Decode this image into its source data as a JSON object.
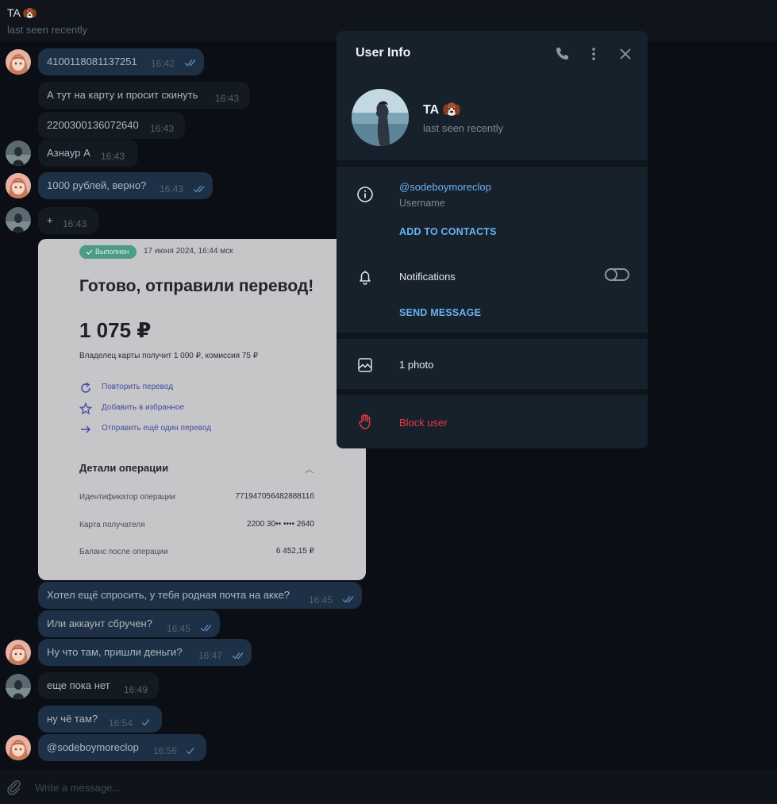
{
  "chat": {
    "title": "TA",
    "title_emoji": "dog-face-emoji",
    "status": "last seen recently",
    "input_placeholder": "Write a message..."
  },
  "messages": [
    {
      "dir": "out",
      "text": "4100118081137251",
      "time": "16:42",
      "read": true
    },
    {
      "dir": "in",
      "text": "А тут на карту и просит скинуть",
      "time": "16:43"
    },
    {
      "dir": "in",
      "text": "2200300136072640",
      "time": "16:43"
    },
    {
      "dir": "in",
      "text": "Азнаур А",
      "time": "16:43"
    },
    {
      "dir": "out",
      "text": "1000 рублей, верно?",
      "time": "16:43",
      "read": true
    },
    {
      "dir": "in",
      "text": "+",
      "time": "16:43"
    },
    {
      "dir": "out",
      "text": "Хотел ещё спросить, у тебя родная почта на акке?",
      "time": "16:45",
      "read": true
    },
    {
      "dir": "out",
      "text": "Или аккаунт сбручен?",
      "time": "16:45",
      "read": true
    },
    {
      "dir": "out",
      "text": "Ну что там, пришли деньги?",
      "time": "16:47",
      "read": true
    },
    {
      "dir": "in",
      "text": "еще пока нет",
      "time": "16:49"
    },
    {
      "dir": "out",
      "text": "ну чё там?",
      "time": "16:54",
      "read": false
    },
    {
      "dir": "out",
      "text": "@sodeboymoreclop",
      "time": "16:56",
      "read": false
    }
  ],
  "receipt": {
    "status_badge": "Выполнен",
    "date": "17 июня 2024, 16:44 мск",
    "heading": "Готово, отправили перевод!",
    "amount": "1 075 ₽",
    "note": "Владелец карты получит 1 000 ₽, комиссия 75 ₽",
    "actions": [
      {
        "icon": "repeat-icon",
        "label": "Повторить перевод"
      },
      {
        "icon": "star-icon",
        "label": "Добавить в избранное"
      },
      {
        "icon": "arrow-right-icon",
        "label": "Отправить ещё один перевод"
      }
    ],
    "details_title": "Детали операции",
    "details": [
      {
        "label": "Идентификатор операции",
        "value": "77194705648288811б"
      },
      {
        "label": "Карта получателя",
        "value": "2200 30•• •••• 2640"
      },
      {
        "label": "Баланс после операции",
        "value": "6 452,15 ₽"
      }
    ]
  },
  "user_info": {
    "title": "User Info",
    "name": "TA",
    "status": "last seen recently",
    "username": "@sodeboymoreclop",
    "username_label": "Username",
    "add_contacts": "ADD TO CONTACTS",
    "notifications_label": "Notifications",
    "notifications_on": false,
    "send_message": "SEND MESSAGE",
    "photos": "1 photo",
    "block": "Block user"
  },
  "colors": {
    "accent": "#6ab2f2",
    "danger": "#ec3942",
    "panel_bg": "#17212b",
    "chat_bg": "#0b0f15",
    "out_bubble": "#1d3046"
  }
}
